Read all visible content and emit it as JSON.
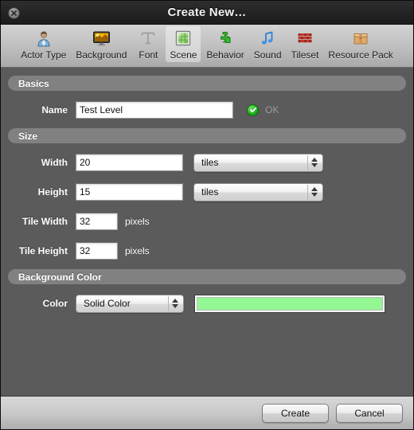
{
  "window": {
    "title": "Create New…",
    "close_icon": "close-icon"
  },
  "toolbar": {
    "items": [
      {
        "label": "Actor Type",
        "icon": "actor-type-icon",
        "selected": false
      },
      {
        "label": "Background",
        "icon": "background-icon",
        "selected": false
      },
      {
        "label": "Font",
        "icon": "font-icon",
        "selected": false
      },
      {
        "label": "Scene",
        "icon": "scene-icon",
        "selected": true
      },
      {
        "label": "Behavior",
        "icon": "behavior-icon",
        "selected": false
      },
      {
        "label": "Sound",
        "icon": "sound-icon",
        "selected": false
      },
      {
        "label": "Tileset",
        "icon": "tileset-icon",
        "selected": false
      },
      {
        "label": "Resource Pack",
        "icon": "resource-pack-icon",
        "selected": false
      }
    ]
  },
  "sections": {
    "basics": {
      "header": "Basics",
      "name_label": "Name",
      "name_value": "Test Level",
      "name_placeholder": "",
      "status_text": "OK",
      "status_icon": "green-check-icon"
    },
    "size": {
      "header": "Size",
      "width_label": "Width",
      "width_value": "20",
      "width_unit": "tiles",
      "height_label": "Height",
      "height_value": "15",
      "height_unit": "tiles",
      "tile_width_label": "Tile Width",
      "tile_width_value": "32",
      "tile_width_unit": "pixels",
      "tile_height_label": "Tile Height",
      "tile_height_value": "32",
      "tile_height_unit": "pixels"
    },
    "background_color": {
      "header": "Background Color",
      "color_label": "Color",
      "mode_value": "Solid Color",
      "swatch_color": "#93F793"
    }
  },
  "footer": {
    "create_label": "Create",
    "cancel_label": "Cancel"
  },
  "colors": {
    "window_background": "#5b5b5b",
    "titlebar": "#232323",
    "section_header": "#818181",
    "ok_green": "#19a615",
    "swatch_green": "#93F793"
  }
}
